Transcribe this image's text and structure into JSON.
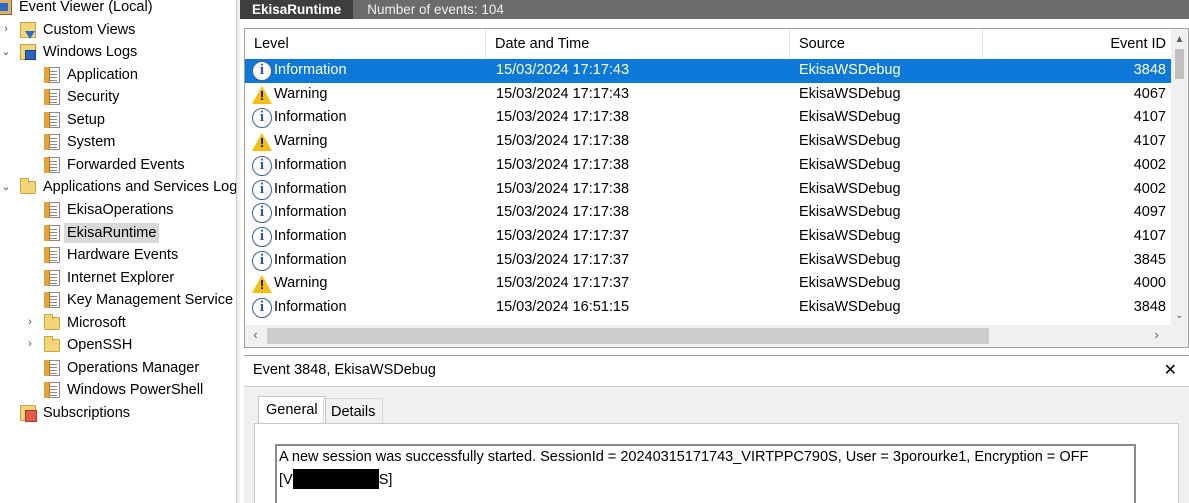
{
  "tree": {
    "items": [
      {
        "label": "Event Viewer (Local)",
        "icon": "event-viewer-icon",
        "chev": ""
      },
      {
        "label": "Custom Views",
        "icon": "custom-views-icon",
        "chev": "›"
      },
      {
        "label": "Windows Logs",
        "icon": "windows-logs-icon",
        "chev": "⌄"
      },
      {
        "label": "Application",
        "icon": "log-icon",
        "chev": ""
      },
      {
        "label": "Security",
        "icon": "log-icon",
        "chev": ""
      },
      {
        "label": "Setup",
        "icon": "log-icon",
        "chev": ""
      },
      {
        "label": "System",
        "icon": "log-icon",
        "chev": ""
      },
      {
        "label": "Forwarded Events",
        "icon": "log-icon",
        "chev": ""
      },
      {
        "label": "Applications and Services Log",
        "icon": "folder-icon",
        "chev": "⌄"
      },
      {
        "label": "EkisaOperations",
        "icon": "log-icon",
        "chev": ""
      },
      {
        "label": "EkisaRuntime",
        "icon": "log-icon",
        "chev": "",
        "selected": true
      },
      {
        "label": "Hardware Events",
        "icon": "log-icon",
        "chev": ""
      },
      {
        "label": "Internet Explorer",
        "icon": "log-icon",
        "chev": ""
      },
      {
        "label": "Key Management Service",
        "icon": "log-icon",
        "chev": ""
      },
      {
        "label": "Microsoft",
        "icon": "folder-icon",
        "chev": "›"
      },
      {
        "label": "OpenSSH",
        "icon": "folder-icon",
        "chev": "›"
      },
      {
        "label": "Operations Manager",
        "icon": "log-icon",
        "chev": ""
      },
      {
        "label": "Windows PowerShell",
        "icon": "log-icon",
        "chev": ""
      },
      {
        "label": "Subscriptions",
        "icon": "subscriptions-icon",
        "chev": ""
      }
    ]
  },
  "header": {
    "log_name": "EkisaRuntime",
    "event_count": "Number of events: 104"
  },
  "table": {
    "columns": [
      "Level",
      "Date and Time",
      "Source",
      "Event ID"
    ],
    "rows": [
      {
        "level": "Information",
        "date": "15/03/2024 17:17:43",
        "source": "EkisaWSDebug",
        "id": "3848",
        "selected": true
      },
      {
        "level": "Warning",
        "date": "15/03/2024 17:17:43",
        "source": "EkisaWSDebug",
        "id": "4067"
      },
      {
        "level": "Information",
        "date": "15/03/2024 17:17:38",
        "source": "EkisaWSDebug",
        "id": "4107"
      },
      {
        "level": "Warning",
        "date": "15/03/2024 17:17:38",
        "source": "EkisaWSDebug",
        "id": "4107"
      },
      {
        "level": "Information",
        "date": "15/03/2024 17:17:38",
        "source": "EkisaWSDebug",
        "id": "4002"
      },
      {
        "level": "Information",
        "date": "15/03/2024 17:17:38",
        "source": "EkisaWSDebug",
        "id": "4002"
      },
      {
        "level": "Information",
        "date": "15/03/2024 17:17:38",
        "source": "EkisaWSDebug",
        "id": "4097"
      },
      {
        "level": "Information",
        "date": "15/03/2024 17:17:37",
        "source": "EkisaWSDebug",
        "id": "4107"
      },
      {
        "level": "Information",
        "date": "15/03/2024 17:17:37",
        "source": "EkisaWSDebug",
        "id": "3845"
      },
      {
        "level": "Warning",
        "date": "15/03/2024 17:17:37",
        "source": "EkisaWSDebug",
        "id": "4000"
      },
      {
        "level": "Information",
        "date": "15/03/2024 16:51:15",
        "source": "EkisaWSDebug",
        "id": "3848"
      }
    ]
  },
  "detail": {
    "title": "Event 3848, EkisaWSDebug",
    "close_glyph": "✕",
    "tabs": [
      "General",
      "Details"
    ],
    "message_line1": "A new session was successfully started. SessionId = 20240315171743_VIRTPPC790S, User = 3porourke1, Encryption = OFF",
    "message_line2_prefix": "[V",
    "message_line2_suffix": "S]"
  },
  "colors": {
    "selection": "#0d78d8",
    "header_bar": "#6b6b6b",
    "warning": "#f2c012"
  }
}
